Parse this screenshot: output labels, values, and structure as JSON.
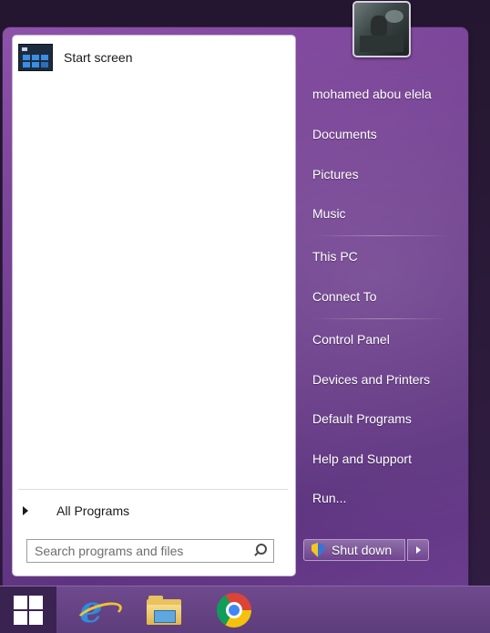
{
  "start_menu": {
    "pinned": [
      {
        "label": "Start screen",
        "icon": "start-screen-icon"
      }
    ],
    "all_programs_label": "All Programs",
    "search": {
      "placeholder": "Search programs and files",
      "value": ""
    },
    "right_pane": {
      "user_name": "mohamed abou elela",
      "items": [
        "Documents",
        "Pictures",
        "Music",
        "This PC",
        "Connect To",
        "Control Panel",
        "Devices and Printers",
        "Default Programs",
        "Help and Support",
        "Run..."
      ]
    },
    "shutdown": {
      "label": "Shut down",
      "icon": "shield-icon"
    }
  },
  "taskbar": {
    "apps": [
      {
        "name": "Windows start",
        "icon": "windows-logo-icon"
      },
      {
        "name": "Internet Explorer",
        "icon": "internet-explorer-icon"
      },
      {
        "name": "File Explorer",
        "icon": "file-explorer-icon"
      },
      {
        "name": "Google Chrome",
        "icon": "chrome-icon"
      }
    ]
  },
  "colors": {
    "menu_purple": "#7b4599",
    "taskbar_purple": "#5e3d7b",
    "start_button": "#3a2350"
  }
}
